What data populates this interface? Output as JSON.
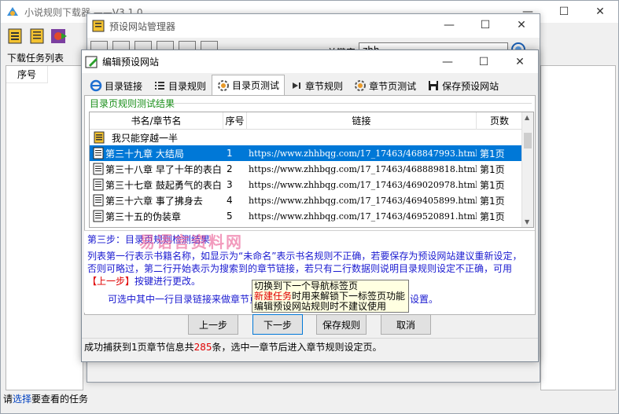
{
  "main": {
    "title": "小说规则下载器     ——V3.1.0",
    "left_label": "下载任务列表",
    "list_header": "序号",
    "status_prefix": "请",
    "status_link": "选择",
    "status_suffix": "要查看的任务"
  },
  "manager": {
    "title": "预设网站管理器",
    "keyword_label": "关键字",
    "keyword_value": "zhh"
  },
  "edit": {
    "title": "编辑预设网站",
    "tabs": [
      {
        "label": "目录链接",
        "icon": "ie-icon"
      },
      {
        "label": "目录规则",
        "icon": "list-icon"
      },
      {
        "label": "目录页测试",
        "icon": "gear-icon"
      },
      {
        "label": "章节规则",
        "icon": "arrow-icon"
      },
      {
        "label": "章节页测试",
        "icon": "gear-icon"
      },
      {
        "label": "保存预设网站",
        "icon": "floppy-icon"
      }
    ],
    "group_label": "目录页规则测试结果",
    "columns": [
      "书名/章节名",
      "序号",
      "链接",
      "页数"
    ],
    "book_row": "我只能穿越一半",
    "rows": [
      {
        "name": "第三十九章 大结局",
        "index": "1",
        "link": "https://www.zhhbqg.com/17_17463/468847993.html",
        "pages": "第1页",
        "selected": true
      },
      {
        "name": "第三十八章 早了十年的表白",
        "index": "2",
        "link": "https://www.zhhbqg.com/17_17463/468889818.html",
        "pages": "第1页"
      },
      {
        "name": "第三十七章 鼓起勇气的表白",
        "index": "3",
        "link": "https://www.zhhbqg.com/17_17463/469020978.html",
        "pages": "第1页"
      },
      {
        "name": "第三十六章 事了拂身去",
        "index": "4",
        "link": "https://www.zhhbqg.com/17_17463/469405899.html",
        "pages": "第1页"
      },
      {
        "name": "第三十五的伪装章",
        "index": "5",
        "link": "https://www.zhhbqg.com/17_17463/469520891.html",
        "pages": "第1页"
      }
    ],
    "desc": {
      "step": "第三步：目录页规则检测结果",
      "para_a": "列表第一行表示书籍名称，如显示为“未命名”表示书名规则不正确，若要保存为预设网站建议重新设定，否则可略过，第二行开始表示为搜索到的章节链接，若只有二行数据则说明目录规则设定不正确，可用",
      "para_red": "【上一步】",
      "para_b": "按键进行更改。",
      "para2": "可选中其中一行目录链接来做章节页测试，点击下一步进行章节正文规则设置。"
    },
    "watermark": "易语言资料网",
    "tooltip": {
      "line1": "切换到下一个导航标签页",
      "line2_red": "新建任务",
      "line2": "时用来解锁下一标签页功能",
      "line3": "编辑预设网站规则时不建议使用"
    },
    "buttons": {
      "prev": "上一步",
      "next": "下一步",
      "save": "保存规则",
      "cancel": "取消"
    },
    "status": {
      "prefix": "成功捕获到1页章节信息共",
      "count": "285",
      "suffix": "条，选中一章节后进入章节规则设定页。"
    }
  }
}
